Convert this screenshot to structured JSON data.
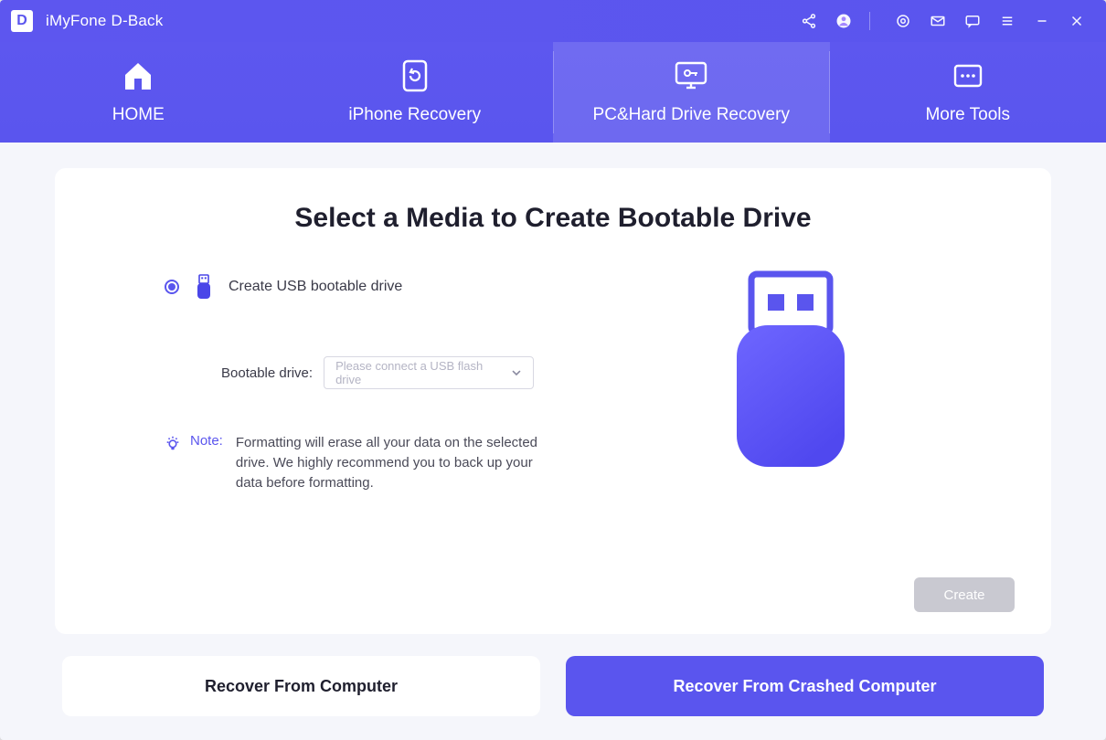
{
  "app": {
    "logo_letter": "D",
    "title": "iMyFone D-Back"
  },
  "titlebar_icons": [
    "share-icon",
    "avatar-icon",
    "settings-gear-icon",
    "mail-icon",
    "chat-icon",
    "menu-icon",
    "minimize-icon",
    "close-icon"
  ],
  "tabs": [
    {
      "id": "home",
      "label": "HOME",
      "active": false
    },
    {
      "id": "iphone",
      "label": "iPhone Recovery",
      "active": false
    },
    {
      "id": "pc",
      "label": "PC&Hard Drive Recovery",
      "active": true
    },
    {
      "id": "more",
      "label": "More Tools",
      "active": false
    }
  ],
  "main": {
    "heading": "Select a Media to Create Bootable Drive",
    "option_label": "Create USB bootable drive",
    "dropdown_label": "Bootable drive:",
    "dropdown_placeholder": "Please connect a USB flash drive",
    "note_label": "Note:",
    "note_text": "Formatting will erase all your data on the selected drive. We highly recommend you to back up your data before formatting.",
    "create_label": "Create"
  },
  "bottom": {
    "left": "Recover From Computer",
    "right": "Recover From Crashed Computer"
  }
}
